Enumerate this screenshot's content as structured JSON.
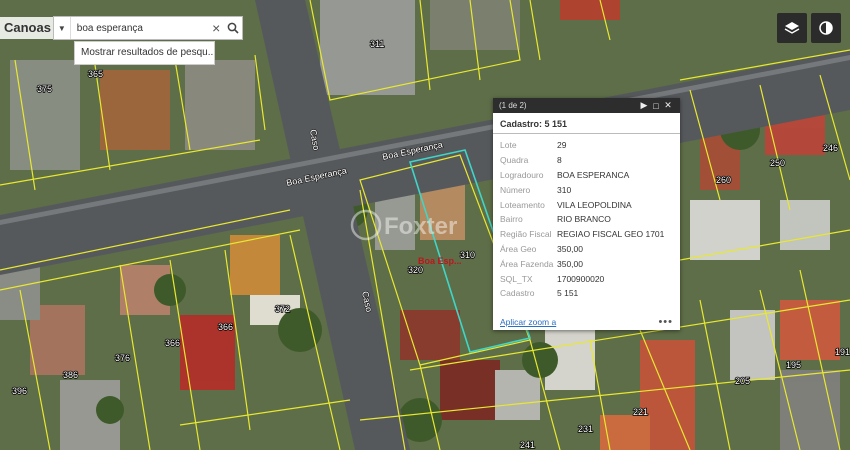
{
  "app": {
    "title": "Canoas"
  },
  "search": {
    "value": "boa esperança",
    "placeholder": "",
    "suggestion": "Mostrar resultados de pesqu..."
  },
  "tools": [
    {
      "name": "layers-icon"
    },
    {
      "name": "basemap-toggle-icon"
    }
  ],
  "map": {
    "streets": [
      {
        "label": "Boa Esperança"
      },
      {
        "label": "Boa Esperança"
      },
      {
        "label": "Caso"
      },
      {
        "label": "Caso"
      }
    ],
    "lots": [
      "311",
      "365",
      "375",
      "260",
      "250",
      "246",
      "320",
      "310",
      "366",
      "372",
      "366",
      "376",
      "386",
      "396",
      "221",
      "231",
      "241",
      "205",
      "195",
      "191"
    ],
    "marker": "Boa Esp...",
    "watermark": "Foxter"
  },
  "popup": {
    "pager": "(1 de 2)",
    "title": "Cadastro: 5 151",
    "fields": [
      {
        "key": "Lote",
        "value": "29"
      },
      {
        "key": "Quadra",
        "value": "8"
      },
      {
        "key": "Logradouro",
        "value": "BOA ESPERANCA"
      },
      {
        "key": "Número",
        "value": "310"
      },
      {
        "key": "Loteamento",
        "value": "VILA LEOPOLDINA"
      },
      {
        "key": "Bairro",
        "value": "RIO BRANCO"
      },
      {
        "key": "Região Fiscal",
        "value": "REGIAO FISCAL GEO 1701"
      },
      {
        "key": "Área Geo",
        "value": "350,00"
      },
      {
        "key": "Área Fazenda",
        "value": "350,00"
      },
      {
        "key": "SQL_TX",
        "value": "1700900020"
      },
      {
        "key": "Cadastro",
        "value": "5 151"
      }
    ],
    "zoom_link": "Aplicar zoom a",
    "more": "•••"
  },
  "colors": {
    "parcel": "#e8e830",
    "selected": "#3fd6c8",
    "road": "#555a5e",
    "popup_header": "#2d2d2d"
  }
}
